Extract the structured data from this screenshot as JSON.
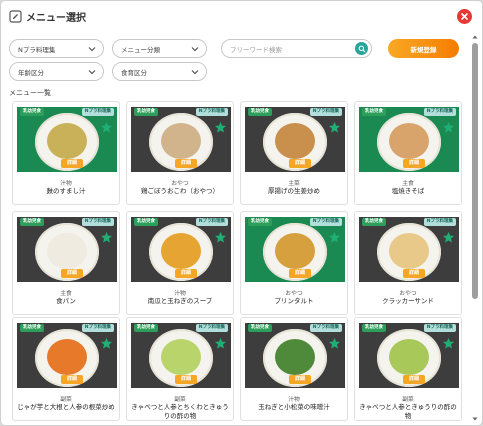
{
  "dialog": {
    "title": "メニュー選択",
    "section_label": "メニュー一覧"
  },
  "filters": {
    "n_plus": "Nプラ料理集",
    "menu_category": "メニュー分類",
    "age_category": "年齢区分",
    "meal_category": "食育区分"
  },
  "search": {
    "placeholder": "フリーワード検索"
  },
  "actions": {
    "new_label": "新規登録",
    "detail_label": "詳細"
  },
  "tags": {
    "infant_meal": "乳幼児食",
    "n_plus": "Nプラ料理集"
  },
  "colors": {
    "accent": "#f57c00",
    "green": "#2e9e5b",
    "teal": "#26a69a",
    "close": "#e53935"
  },
  "menus": [
    {
      "category": "汁物",
      "name": "麩のすまし汁",
      "bg": "green",
      "food": "#c9b15a"
    },
    {
      "category": "おやつ",
      "name": "鶏ごぼうおこわ（おやつ）",
      "bg": "dark",
      "food": "#d2b48c"
    },
    {
      "category": "主菜",
      "name": "厚揚げの生姜炒め",
      "bg": "dark",
      "food": "#c98f4c"
    },
    {
      "category": "主食",
      "name": "塩焼きそば",
      "bg": "green",
      "food": "#d9a46b"
    },
    {
      "category": "主食",
      "name": "食パン",
      "bg": "dark",
      "food": "#f0ebe0"
    },
    {
      "category": "汁物",
      "name": "南瓜と玉ねぎのスープ",
      "bg": "dark",
      "food": "#e6a533"
    },
    {
      "category": "おやつ",
      "name": "プリンタルト",
      "bg": "green",
      "food": "#d7a03e"
    },
    {
      "category": "おやつ",
      "name": "クラッカーサンド",
      "bg": "dark",
      "food": "#e8c98a"
    },
    {
      "category": "副菜",
      "name": "じゃが芋と大根と人参の根菜炒め",
      "bg": "dark",
      "food": "#e7792b"
    },
    {
      "category": "副菜",
      "name": "きゃべつと人参とちくわときゅうりの酢の物",
      "bg": "dark",
      "food": "#b8d46a"
    },
    {
      "category": "汁物",
      "name": "玉ねぎと小松菜の味噌汁",
      "bg": "dark",
      "food": "#4f8a3a"
    },
    {
      "category": "副菜",
      "name": "きゃべつと人参ときゅうりの酢の物",
      "bg": "dark",
      "food": "#a8c85a"
    }
  ]
}
